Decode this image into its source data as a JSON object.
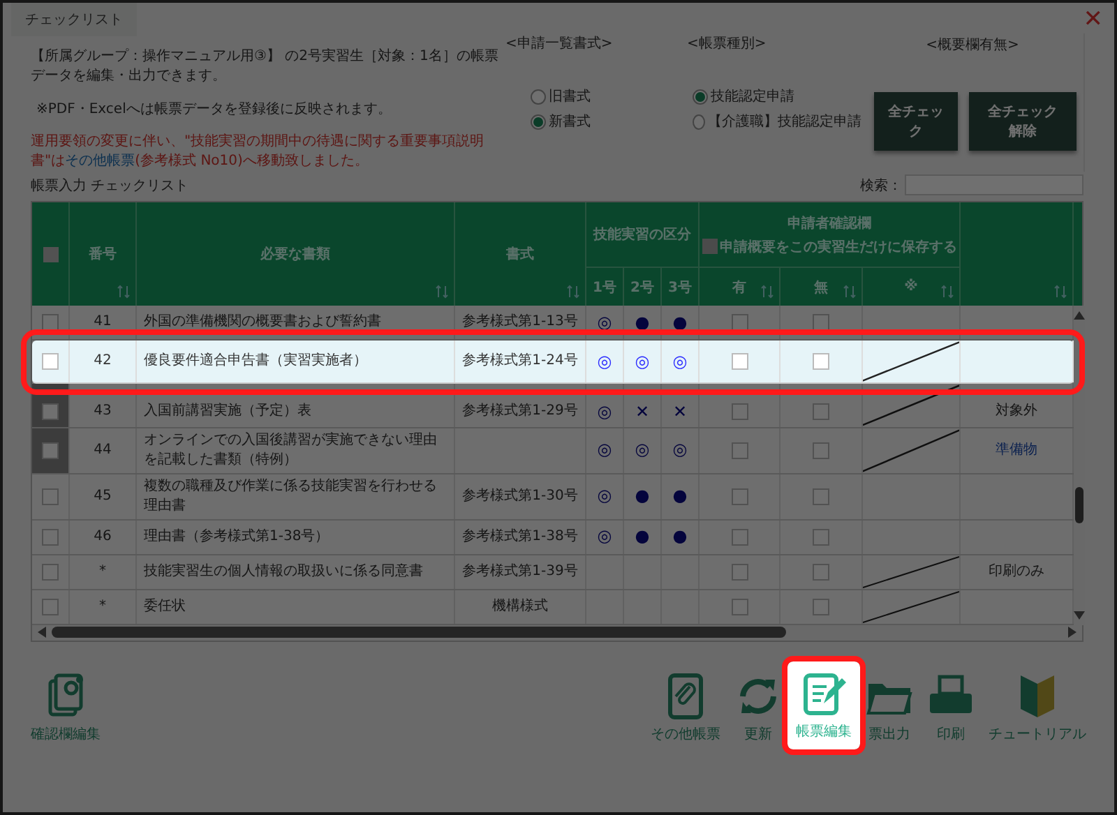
{
  "window": {
    "title": "チェックリスト",
    "close": "✕"
  },
  "info": {
    "description": "【所属グループ：操作マニュアル用③】 の2号実習生［対象：1名］の帳票データを編集・出力できます。",
    "note": "※PDF・Excelへは帳票データを登録後に反映されます。",
    "notice_before": "運用要領の変更に伴い、\"技能実習の期間中の待遇に関する重要事項説明書\"は",
    "notice_link": "その他帳票",
    "notice_after": "(参考様式 No10)へ移動致しました。"
  },
  "options": [
    {
      "heading": "<申請一覧書式>",
      "radios": [
        {
          "label": "旧書式",
          "selected": false
        },
        {
          "label": "新書式",
          "selected": true
        }
      ]
    },
    {
      "heading": "<帳票種別>",
      "radios": [
        {
          "label": "技能認定申請",
          "selected": true
        },
        {
          "label": "【介護職】技能認定申請",
          "selected": false
        }
      ]
    },
    {
      "heading": "<概要欄有無>",
      "buttons": [
        "全チェック",
        "全チェック解除"
      ]
    }
  ],
  "section_title": "帳票入力 チェックリスト",
  "search": {
    "label": "検索："
  },
  "table": {
    "header": {
      "select_all": {
        "checked": false
      },
      "number": "番号",
      "document": "必要な書類",
      "format": "書式",
      "category": "技能実習の区分",
      "category_columns": [
        "1号",
        "2号",
        "3号"
      ],
      "confirm": "申請者確認欄",
      "save_option": {
        "label": "申請概要をこの実習生だけに保存する",
        "checked": false
      },
      "confirm_columns": [
        "有",
        "無",
        "※"
      ]
    },
    "rows": [
      {
        "checked": false,
        "disabled": false,
        "highlighted": false,
        "number": "41",
        "document": "外国の準備機関の概要書および誓約書",
        "format": "参考様式第1-13号",
        "marks": [
          "◎",
          "●",
          "●"
        ],
        "yes": false,
        "no": false,
        "slashed": false
      },
      {
        "checked": false,
        "disabled": false,
        "highlighted": true,
        "number": "42",
        "document": "優良要件適合申告書（実習実施者）",
        "format": "参考様式第1-24号",
        "marks": [
          "◎",
          "◎",
          "◎"
        ],
        "yes": false,
        "no": false,
        "slashed": true
      },
      {
        "checked": false,
        "disabled": true,
        "highlighted": false,
        "number": "43",
        "document": "入国前講習実施（予定）表",
        "format": "参考様式第1-29号",
        "marks": [
          "◎",
          "✕",
          "✕"
        ],
        "yes": false,
        "no": false,
        "slashed": true,
        "note": {
          "text": "対象外",
          "kind": "text"
        }
      },
      {
        "checked": false,
        "disabled": true,
        "highlighted": false,
        "number": "44",
        "document": "オンラインでの入国後講習が実施できない理由を記載した書類（特例）",
        "marks": [
          "◎",
          "◎",
          "◎"
        ],
        "yes": false,
        "no": false,
        "slashed": true,
        "note": {
          "text": "準備物",
          "kind": "link"
        }
      },
      {
        "checked": false,
        "disabled": false,
        "highlighted": false,
        "number": "45",
        "document": "複数の職種及び作業に係る技能実習を行わせる理由書",
        "format": "参考様式第1-30号",
        "marks": [
          "◎",
          "●",
          "●"
        ],
        "yes": false,
        "no": false,
        "slashed": false
      },
      {
        "checked": false,
        "disabled": false,
        "highlighted": false,
        "number": "46",
        "document": "理由書（参考様式第1-38号）",
        "format": "参考様式第1-38号",
        "marks": [
          "◎",
          "●",
          "●"
        ],
        "yes": false,
        "no": false,
        "slashed": false
      },
      {
        "checked": false,
        "disabled": false,
        "highlighted": false,
        "number": "*",
        "document": "技能実習生の個人情報の取扱いに係る同意書",
        "format": "参考様式第1-39号",
        "marks": [],
        "yes": false,
        "no": false,
        "slashed": true,
        "note": {
          "text": "印刷のみ",
          "kind": "text"
        }
      },
      {
        "checked": false,
        "disabled": false,
        "highlighted": false,
        "number": "*",
        "document": "委任状",
        "format": "機構様式",
        "marks": [],
        "yes": false,
        "no": false,
        "slashed": true
      }
    ]
  },
  "toolbar_left": [
    {
      "kind": "settings",
      "label": "確認欄編集",
      "highlighted": false
    }
  ],
  "toolbar_right": [
    {
      "kind": "clip",
      "label": "その他帳票",
      "highlighted": false
    },
    {
      "kind": "refresh",
      "label": "更新",
      "highlighted": false
    },
    {
      "kind": "edit",
      "label": "帳票編集",
      "highlighted": true
    },
    {
      "kind": "folder",
      "label": "票出力",
      "highlighted": false
    },
    {
      "kind": "print",
      "label": "印刷",
      "highlighted": false
    },
    {
      "kind": "leaf",
      "label": "チュートリアル",
      "highlighted": false
    }
  ]
}
